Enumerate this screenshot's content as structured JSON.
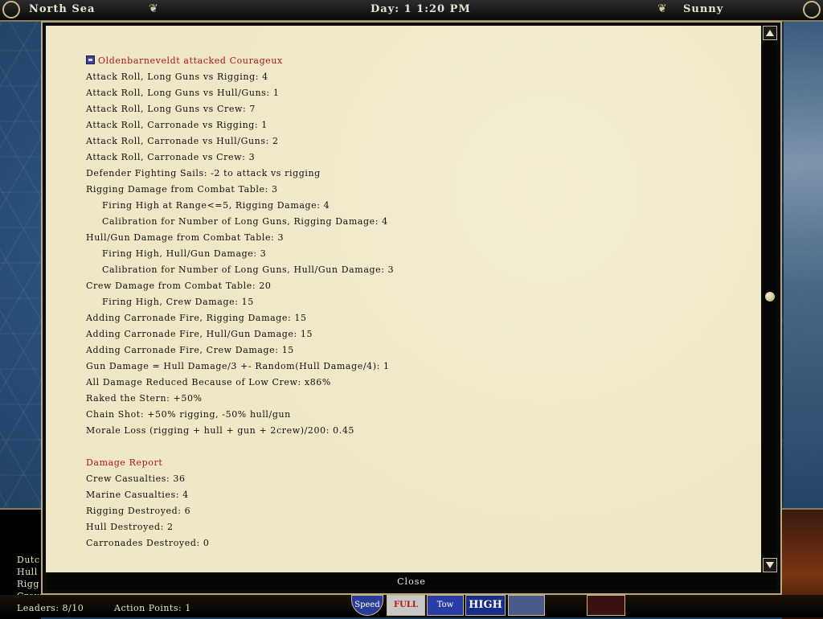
{
  "topbar": {
    "location": "North Sea",
    "daytime": "Day: 1  1:20 PM",
    "weather": "Sunny"
  },
  "dialog": {
    "attack_header": "Oldenbarneveldt attacked Courageux",
    "lines": [
      {
        "text": "Attack Roll, Long Guns vs Rigging: 4",
        "indent": false
      },
      {
        "text": "Attack Roll, Long Guns vs Hull/Guns: 1",
        "indent": false
      },
      {
        "text": "Attack Roll, Long Guns vs Crew: 7",
        "indent": false
      },
      {
        "text": "Attack Roll, Carronade vs Rigging: 1",
        "indent": false
      },
      {
        "text": "Attack Roll, Carronade vs Hull/Guns: 2",
        "indent": false
      },
      {
        "text": "Attack Roll, Carronade vs Crew: 3",
        "indent": false
      },
      {
        "text": "Defender Fighting Sails: -2 to attack vs rigging",
        "indent": false
      },
      {
        "text": "Rigging Damage from Combat Table: 3",
        "indent": false
      },
      {
        "text": "Firing High at Range<=5, Rigging Damage: 4",
        "indent": true
      },
      {
        "text": "Calibration for Number of Long Guns, Rigging Damage: 4",
        "indent": true
      },
      {
        "text": "Hull/Gun Damage from Combat Table: 3",
        "indent": false
      },
      {
        "text": "Firing High, Hull/Gun Damage: 3",
        "indent": true
      },
      {
        "text": "Calibration for Number of Long Guns, Hull/Gun Damage: 3",
        "indent": true
      },
      {
        "text": "Crew Damage from Combat Table: 20",
        "indent": false
      },
      {
        "text": "Firing High, Crew Damage: 15",
        "indent": true
      },
      {
        "text": "Adding Carronade Fire, Rigging Damage: 15",
        "indent": false
      },
      {
        "text": "Adding Carronade Fire, Hull/Gun Damage: 15",
        "indent": false
      },
      {
        "text": "Adding Carronade Fire, Crew Damage: 15",
        "indent": false
      },
      {
        "text": "Gun Damage = Hull Damage/3 +- Random(Hull Damage/4): 1",
        "indent": false
      },
      {
        "text": "All Damage Reduced Because of Low Crew: x86%",
        "indent": false
      },
      {
        "text": "Raked the Stern: +50%",
        "indent": false
      },
      {
        "text": "Chain Shot: +50% rigging, -50% hull/gun",
        "indent": false
      },
      {
        "text": "Morale Loss (rigging + hull + gun + 2crew)/200: 0.45",
        "indent": false
      }
    ],
    "damage_header": "Damage Report",
    "damage_lines": [
      "Crew Casualties: 36",
      "Marine Casualties: 4",
      "Rigging Destroyed: 6",
      "Hull Destroyed: 2",
      "Carronades Destroyed: 0"
    ],
    "close_label": "Close"
  },
  "background_ui": {
    "side_labels": [
      "Dutc",
      "Hull",
      "Rigg",
      "Crew"
    ],
    "leaders": "Leaders: 8/10",
    "action_points": "Action Points: 1",
    "speed_label": "Speed",
    "full_label": "FULL",
    "tow_label": "Tow",
    "high_label": "HIGH"
  }
}
